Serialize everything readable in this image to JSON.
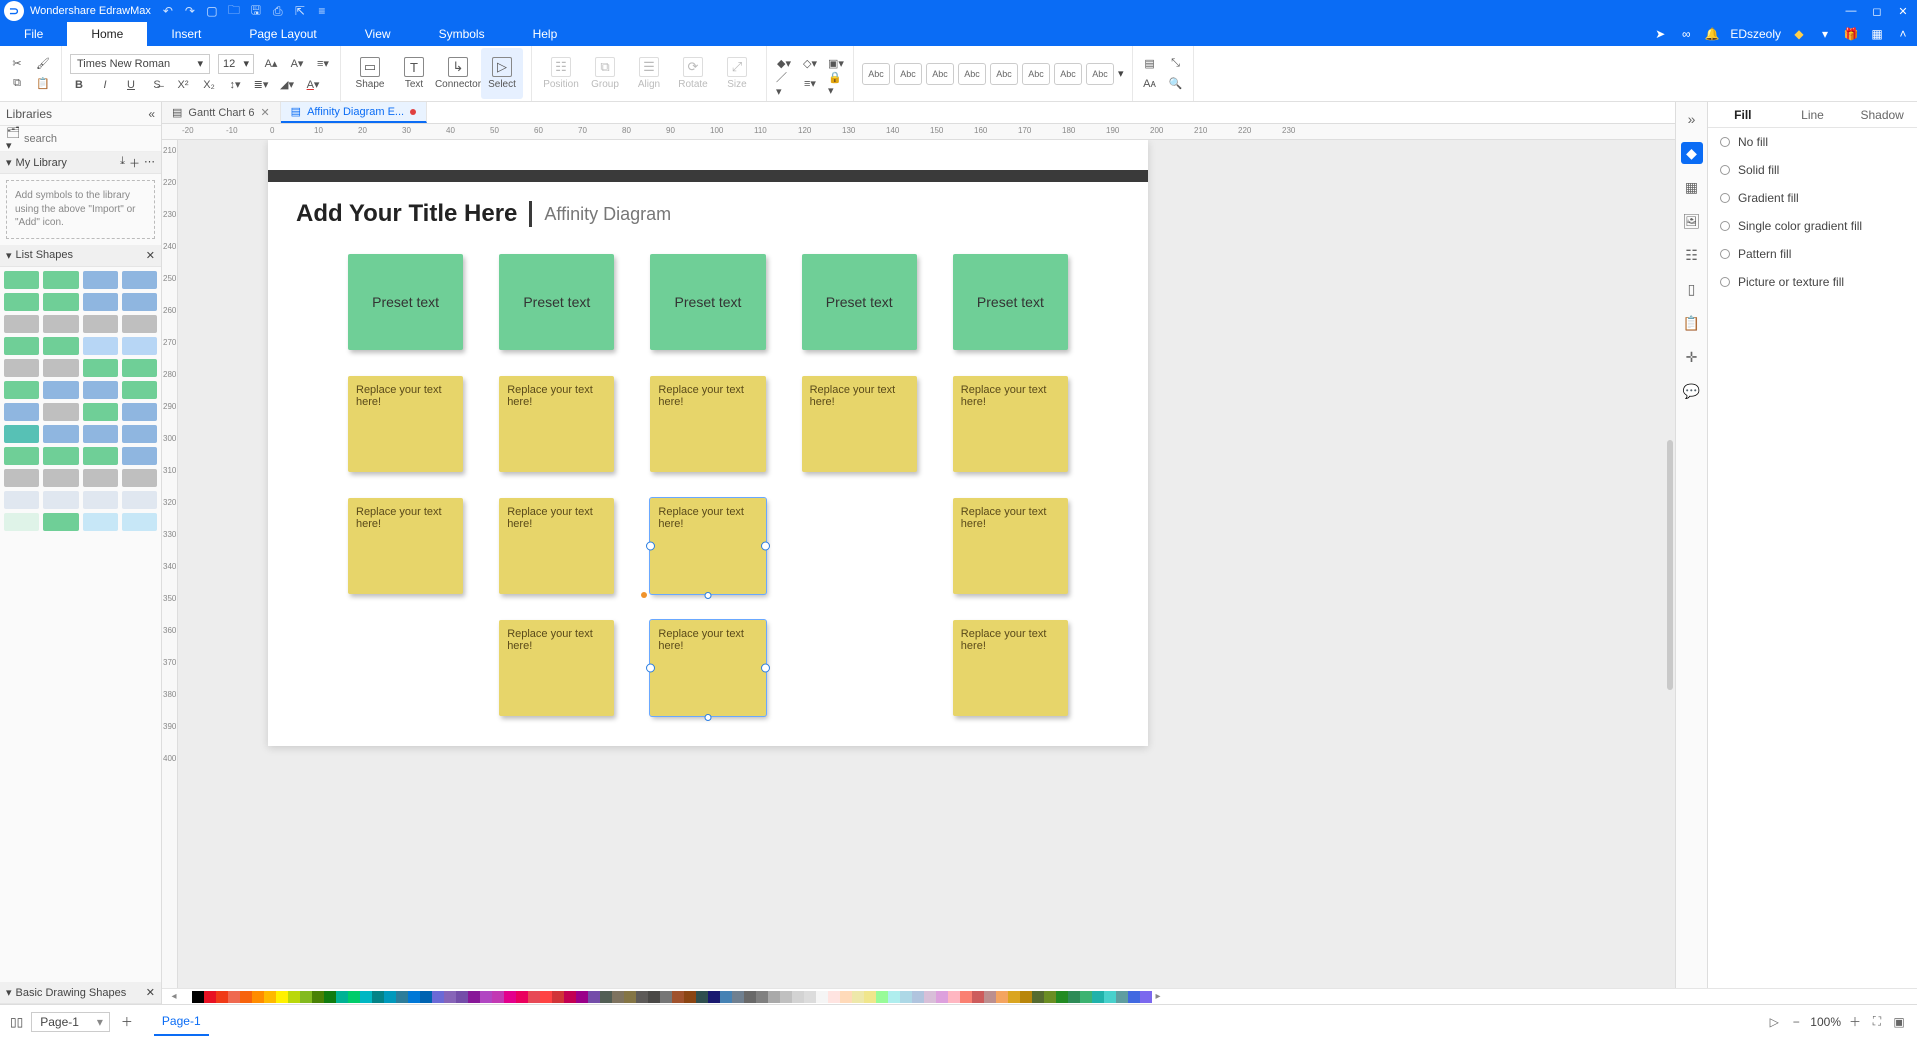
{
  "app": {
    "name": "Wondershare EdrawMax",
    "user": "EDszeoly"
  },
  "menus": {
    "file": "File",
    "home": "Home",
    "insert": "Insert",
    "page_layout": "Page Layout",
    "view": "View",
    "symbols": "Symbols",
    "help": "Help"
  },
  "ribbon": {
    "font": "Times New Roman",
    "size": "12",
    "shape": "Shape",
    "text": "Text",
    "connector": "Connector",
    "select": "Select",
    "position": "Position",
    "group": "Group",
    "align": "Align",
    "rotate": "Rotate",
    "size_lbl": "Size",
    "style_label": "Abc"
  },
  "libraries": {
    "title": "Libraries",
    "search_placeholder": "search",
    "mylib": "My Library",
    "addmsg": "Add symbols to the library using the above \"Import\" or \"Add\" icon.",
    "list_shapes": "List Shapes",
    "basic_shapes": "Basic Drawing Shapes"
  },
  "tabs": {
    "t1": "Gantt Chart 6",
    "t2": "Affinity Diagram E...",
    "modified": true
  },
  "doc": {
    "title": "Add Your Title Here",
    "subtitle": "Affinity Diagram",
    "preset": "Preset text",
    "replace": "Replace your text here!"
  },
  "right_tabs": {
    "fill": "Fill",
    "line": "Line",
    "shadow": "Shadow"
  },
  "fill_opts": {
    "nofill": "No fill",
    "solid": "Solid fill",
    "gradient": "Gradient fill",
    "single": "Single color gradient fill",
    "pattern": "Pattern fill",
    "picture": "Picture or texture fill"
  },
  "status": {
    "page_dd": "Page-1",
    "page_tab": "Page-1",
    "zoom": "100%"
  },
  "ruler_h": [
    -20,
    -10,
    0,
    10,
    20,
    30,
    40,
    50,
    60,
    70,
    80,
    90,
    100,
    110,
    120,
    130,
    140,
    150,
    160,
    170,
    180,
    190,
    200,
    210,
    220,
    230
  ],
  "ruler_v": [
    210,
    220,
    230,
    240,
    250,
    260,
    270,
    280,
    290,
    300,
    310,
    320,
    330,
    340,
    350,
    360,
    370,
    380,
    390,
    400
  ],
  "thumb_colors": [
    "#6fcf97",
    "#6fcf97",
    "#8fb6e0",
    "#8fb6e0",
    "#6fcf97",
    "#6fcf97",
    "#8fb6e0",
    "#8fb6e0",
    "#bfbfbf",
    "#bfbfbf",
    "#bfbfbf",
    "#bfbfbf",
    "#6fcf97",
    "#6fcf97",
    "#b7d6f5",
    "#b7d6f5",
    "#bfbfbf",
    "#bfbfbf",
    "#6fcf97",
    "#6fcf97",
    "#6fcf97",
    "#8fb6e0",
    "#8fb6e0",
    "#6fcf97",
    "#8fb6e0",
    "#bfbfbf",
    "#6fcf97",
    "#8fb6e0",
    "#57c1b5",
    "#8fb6e0",
    "#8fb6e0",
    "#8fb6e0",
    "#6fcf97",
    "#6fcf97",
    "#6fcf97",
    "#8fb6e0",
    "#bfbfbf",
    "#bfbfbf",
    "#bfbfbf",
    "#bfbfbf",
    "#e0e7f0",
    "#e0e7f0",
    "#e0e7f0",
    "#e0e7f0",
    "#dff3e8",
    "#6fcf97",
    "#c7e7f7",
    "#c7e7f7"
  ],
  "color_swatches": [
    "#ffffff",
    "#000000",
    "#e81123",
    "#f03a17",
    "#ef6950",
    "#f7630c",
    "#ff8c00",
    "#ffb900",
    "#fff100",
    "#bad80a",
    "#83ba1f",
    "#498205",
    "#107c10",
    "#00b294",
    "#00cc6a",
    "#00b7c3",
    "#038387",
    "#0099bc",
    "#2d7d9a",
    "#0078d7",
    "#0063b1",
    "#6b69d6",
    "#8764b8",
    "#744da9",
    "#881798",
    "#b146c2",
    "#c239b3",
    "#e3008c",
    "#ea005e",
    "#e74856",
    "#ff4343",
    "#d13438",
    "#c30052",
    "#9a0089",
    "#744da9",
    "#525e54",
    "#7e735f",
    "#847545",
    "#5d5a58",
    "#4a4846",
    "#767676",
    "#a0522d",
    "#8b4513",
    "#2f4f4f",
    "#191970",
    "#4682b4",
    "#708090",
    "#696969",
    "#808080",
    "#a9a9a9",
    "#c0c0c0",
    "#d3d3d3",
    "#dcdcdc",
    "#f5f5f5",
    "#ffe4e1",
    "#ffdab9",
    "#eee8aa",
    "#f0e68c",
    "#98fb98",
    "#afeeee",
    "#add8e6",
    "#b0c4de",
    "#d8bfd8",
    "#dda0dd",
    "#ffb6c1",
    "#fa8072",
    "#cd5c5c",
    "#bc8f8f",
    "#f4a460",
    "#daa520",
    "#b8860b",
    "#556b2f",
    "#6b8e23",
    "#228b22",
    "#2e8b57",
    "#3cb371",
    "#20b2aa",
    "#48d1cc",
    "#5f9ea0",
    "#4169e1",
    "#7b68ee"
  ]
}
